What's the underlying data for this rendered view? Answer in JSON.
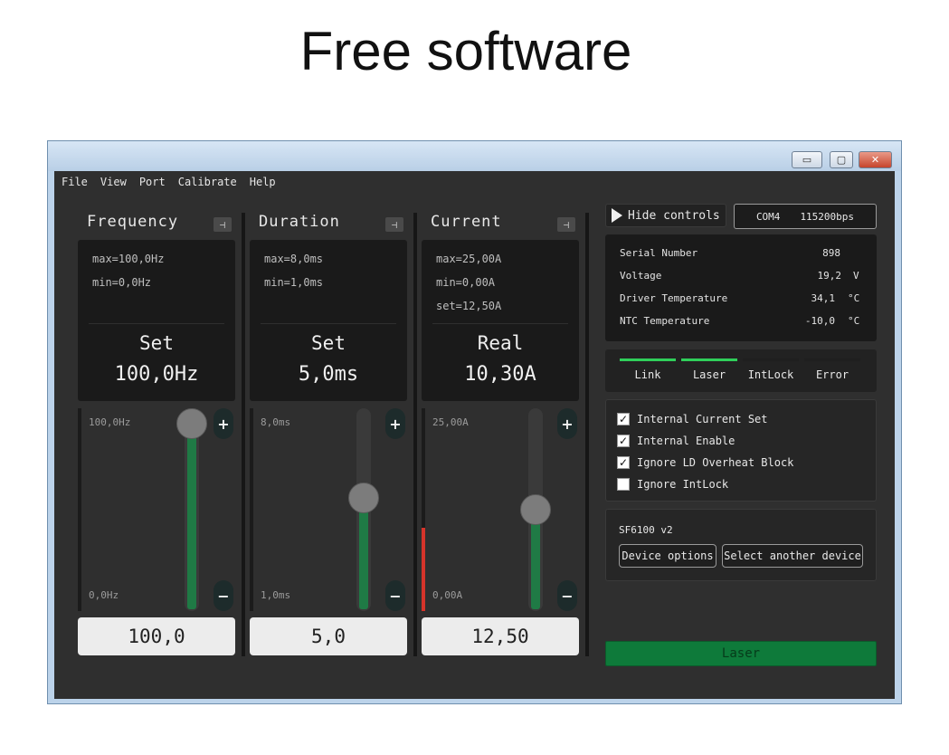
{
  "slide": {
    "title": "Free software"
  },
  "window": {
    "minimize": "▭",
    "maximize": "▢",
    "close": "✕"
  },
  "menu": [
    "File",
    "View",
    "Port",
    "Calibrate",
    "Help"
  ],
  "columns": [
    {
      "title": "Frequency",
      "info": [
        "max=100,0Hz",
        "min=0,0Hz",
        ""
      ],
      "label": "Set",
      "value": "100,0Hz",
      "slider_max": "100,0Hz",
      "slider_min": "0,0Hz",
      "slider_level": 1.0,
      "input_value": "100,0"
    },
    {
      "title": "Duration",
      "info": [
        "max=8,0ms",
        "min=1,0ms",
        ""
      ],
      "label": "Set",
      "value": "5,0ms",
      "slider_max": "8,0ms",
      "slider_min": "1,0ms",
      "slider_level": 0.57,
      "input_value": "5,0"
    },
    {
      "title": "Current",
      "info": [
        "max=25,00A",
        "min=0,00A",
        "set=12,50A"
      ],
      "label": "Real",
      "value": "10,30A",
      "slider_max": "25,00A",
      "slider_min": "0,00A",
      "slider_level": 0.5,
      "real_level": 0.41,
      "input_value": "12,50"
    }
  ],
  "controls": {
    "plus": "+",
    "minus": "−",
    "pin": "⊣"
  },
  "hide_controls": "Hide controls",
  "port": {
    "name": "COM4",
    "baud": "115200bps"
  },
  "status": [
    {
      "label": "Serial Number",
      "value": "898",
      "unit": ""
    },
    {
      "label": "Voltage",
      "value": "19,2",
      "unit": "V"
    },
    {
      "label": "Driver Temperature",
      "value": "34,1",
      "unit": "°C"
    },
    {
      "label": "NTC Temperature",
      "value": "-10,0",
      "unit": "°C"
    }
  ],
  "indicators": [
    {
      "label": "Link",
      "on": true
    },
    {
      "label": "Laser",
      "on": true
    },
    {
      "label": "IntLock",
      "on": false
    },
    {
      "label": "Error",
      "on": false
    }
  ],
  "options": [
    {
      "label": "Internal Current Set",
      "checked": true
    },
    {
      "label": "Internal Enable",
      "checked": true
    },
    {
      "label": "Ignore LD Overheat Block",
      "checked": true
    },
    {
      "label": "Ignore IntLock",
      "checked": false
    }
  ],
  "device": {
    "name": "SF6100 v2",
    "options_button": "Device options",
    "select_button": "Select another device"
  },
  "laser_button": "Laser",
  "colors": {
    "fill": "#1f7a45",
    "indicator_on": "#2fcf5a",
    "laser": "#0e7a3a",
    "real_bar": "#d6342a"
  }
}
